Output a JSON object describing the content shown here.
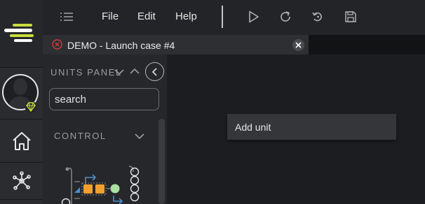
{
  "menu": {
    "file": "File",
    "edit": "Edit",
    "help": "Help"
  },
  "tab": {
    "title": "DEMO - Launch case #4"
  },
  "units_panel": {
    "title": "UNITS PANEL",
    "search_value": "search",
    "section": "CONTROL"
  },
  "context_menu": {
    "add_unit": "Add unit"
  },
  "colors": {
    "accent_green": "#c8dc3c",
    "close_red": "#d23c3c",
    "node_orange": "#f0a030",
    "node_blue": "#4a90d0",
    "node_green": "#a8e0a0"
  }
}
